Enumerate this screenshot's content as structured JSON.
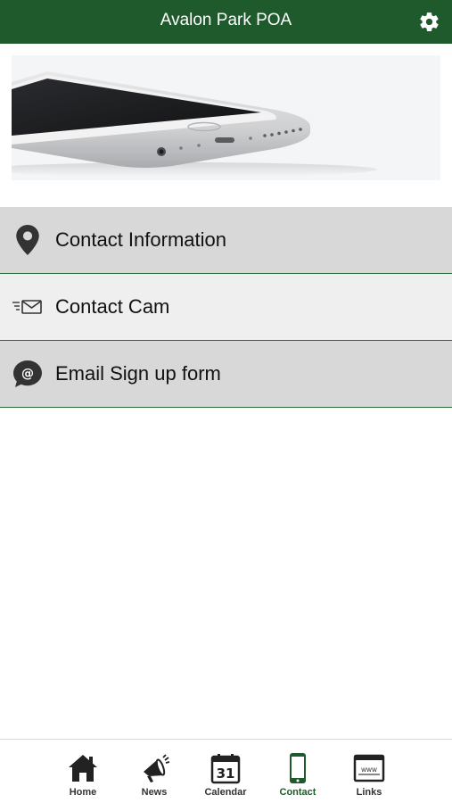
{
  "header": {
    "title": "Avalon Park POA",
    "settings_icon": "gear-icon"
  },
  "hero": {
    "image": "smartphone-photo"
  },
  "menu": {
    "items": [
      {
        "label": "Contact Information",
        "icon": "map-pin-icon"
      },
      {
        "label": "Contact Cam",
        "icon": "envelope-icon"
      },
      {
        "label": "Email Sign up form",
        "icon": "at-sign-icon"
      }
    ]
  },
  "tabbar": {
    "tabs": [
      {
        "label": "Home",
        "icon": "home-icon",
        "active": false
      },
      {
        "label": "News",
        "icon": "megaphone-icon",
        "active": false
      },
      {
        "label": "Calendar",
        "icon": "calendar-icon",
        "active": false,
        "day": "31"
      },
      {
        "label": "Contact",
        "icon": "phone-icon",
        "active": true
      },
      {
        "label": "Links",
        "icon": "browser-window-icon",
        "active": false,
        "caption": "WWW"
      }
    ]
  },
  "colors": {
    "brand": "#1e5a2c",
    "menu_dark": "#d8d8d8",
    "menu_light": "#efefef"
  }
}
